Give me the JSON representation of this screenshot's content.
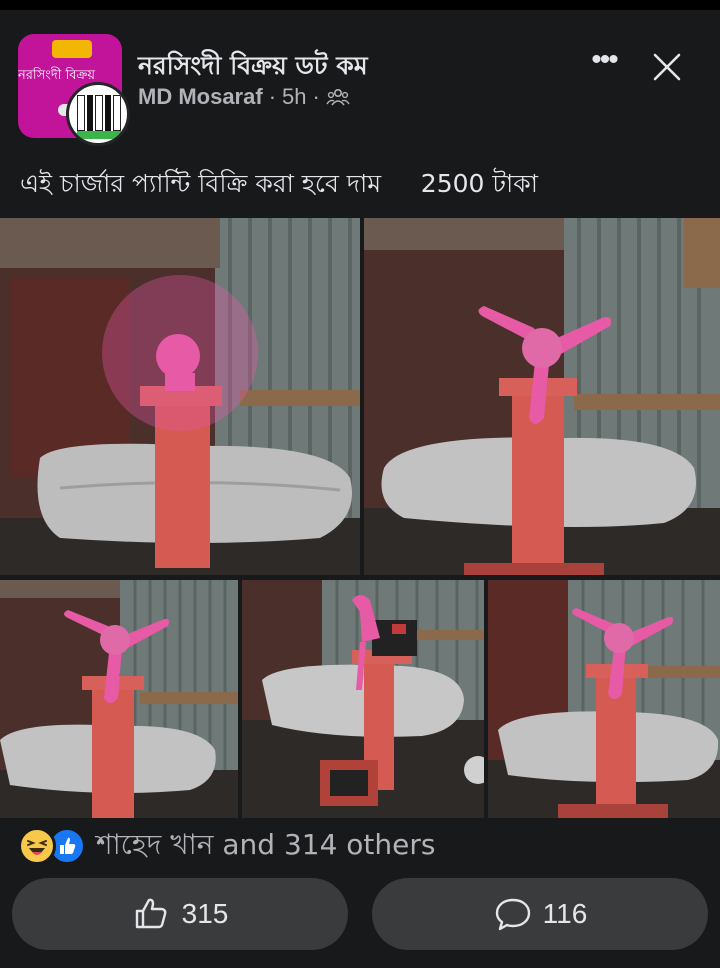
{
  "post": {
    "group_name": "নরসিংদী বিক্রয় ডট কম",
    "group_avatar_text": "নরসিংদী বিক্রয়",
    "author": "MD Mosaraf",
    "time": "5h",
    "separator": "·",
    "caption": "এই চার্জার প্যান্টি বিক্রি করা হবে দাম     2500 টাকা"
  },
  "header_actions": {
    "more_label": "•••"
  },
  "reactions": {
    "summary": "শাহেদ খান and 314 others",
    "types": [
      "haha",
      "like"
    ]
  },
  "actions": {
    "like_count": "315",
    "comment_count": "116"
  },
  "icons": {
    "more": "more-dots-icon",
    "close": "close-icon",
    "audience": "group-audience-icon",
    "like": "thumbs-up-icon",
    "comment": "comment-bubble-icon",
    "haha": "haha-emoji-icon",
    "like_reaction": "like-reaction-icon"
  },
  "colors": {
    "background": "#18191a",
    "text_primary": "#e4e6eb",
    "text_secondary": "#b0b3b8",
    "button_bg": "#3a3b3c",
    "like_blue": "#1877f2",
    "haha_yellow": "#f7c94a",
    "avatar_magenta": "#c2139b",
    "fan_pink": "#e65aa6"
  }
}
